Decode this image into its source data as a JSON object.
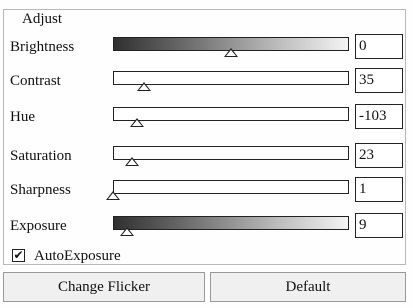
{
  "group_title": "Adjust",
  "rows": [
    {
      "label": "Brightness",
      "value": "0",
      "level": 0.5,
      "gradient": true
    },
    {
      "label": "Contrast",
      "value": "35",
      "level": 0.13,
      "gradient": false
    },
    {
      "label": "Hue",
      "value": "-103",
      "level": 0.1,
      "gradient": false
    },
    {
      "label": "Saturation",
      "value": "23",
      "level": 0.08,
      "gradient": false
    },
    {
      "label": "Sharpness",
      "value": "1",
      "level": 0.0,
      "gradient": false
    },
    {
      "label": "Exposure",
      "value": "9",
      "level": 0.06,
      "gradient": true
    }
  ],
  "auto_exposure": {
    "label": "AutoExposure",
    "checked": true,
    "check_glyph": "✔"
  },
  "buttons": {
    "change_flicker": "Change Flicker",
    "default": "Default"
  }
}
